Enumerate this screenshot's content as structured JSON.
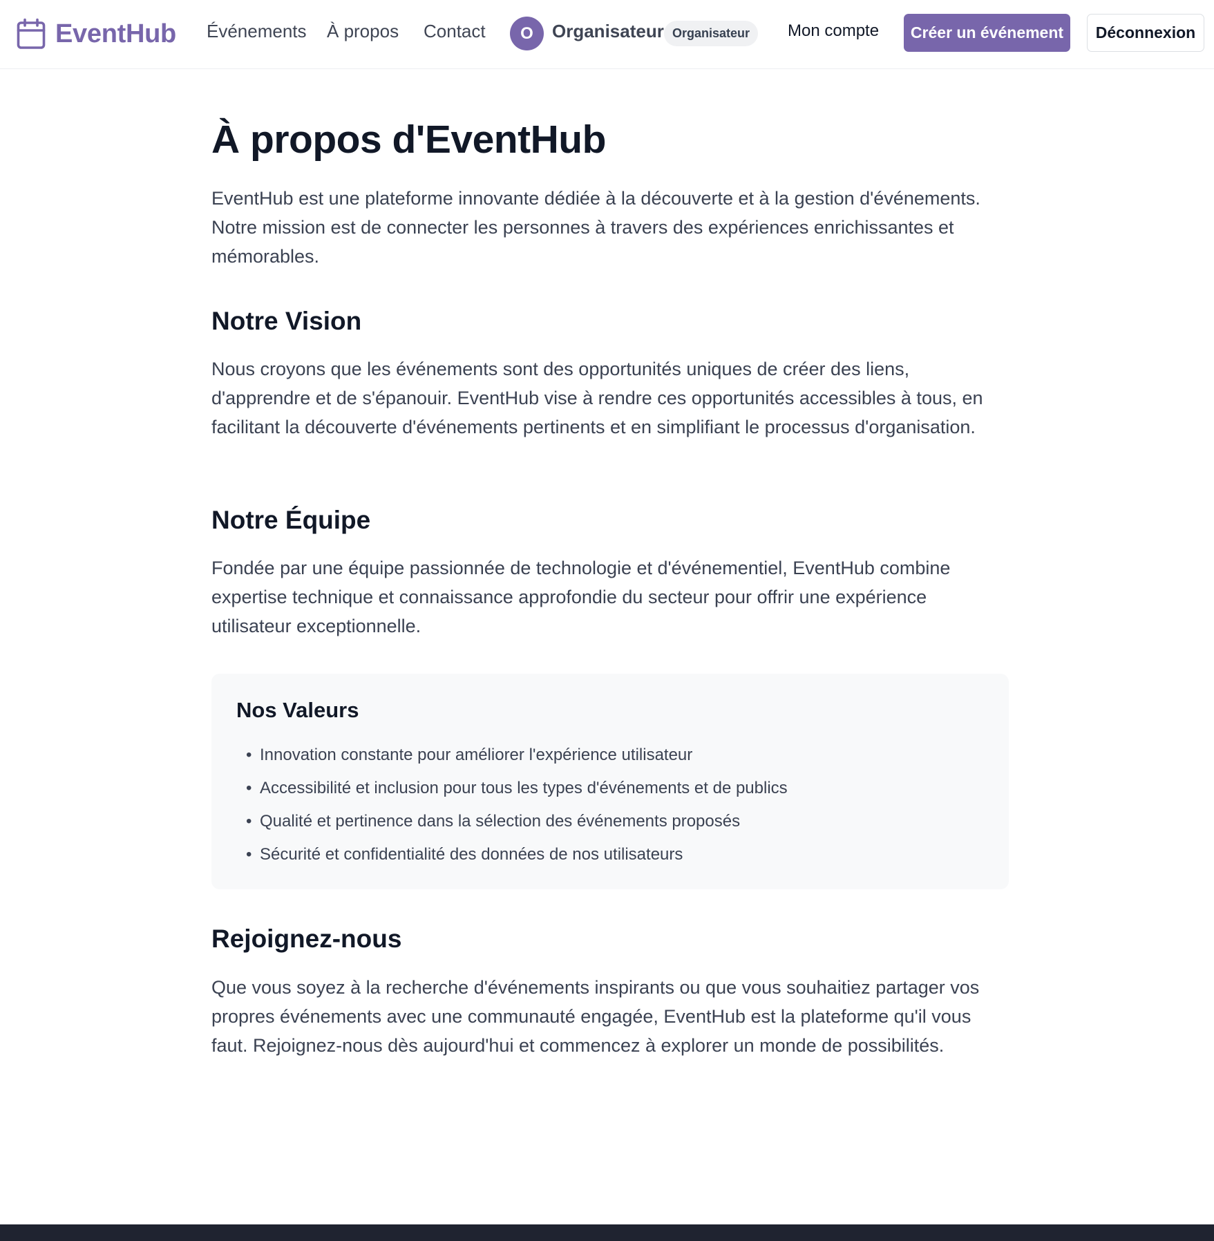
{
  "brand": {
    "name": "EventHub",
    "accent_color": "#7866ab",
    "logo_icon": "calendar-icon"
  },
  "nav": {
    "links": [
      "Événements",
      "À propos",
      "Contact"
    ]
  },
  "user": {
    "initial": "O",
    "name": "Organisateur",
    "role_badge": "Organisateur",
    "account_link": "Mon compte"
  },
  "actions": {
    "create_event": "Créer un événement",
    "logout": "Déconnexion"
  },
  "page": {
    "title": "À propos d'EventHub",
    "intro": "EventHub est une plateforme innovante dédiée à la découverte et à la gestion d'événements. Notre mission est de connecter les personnes à travers des expériences enrichissantes et mémorables.",
    "sections": [
      {
        "heading": "Notre Vision",
        "text": "Nous croyons que les événements sont des opportunités uniques de créer des liens, d'apprendre et de s'épanouir. EventHub vise à rendre ces opportunités accessibles à tous, en facilitant la découverte d'événements pertinents et en simplifiant le processus d'organisation."
      },
      {
        "heading": "Notre Équipe",
        "text": "Fondée par une équipe passionnée de technologie et d'événementiel, EventHub combine expertise technique et connaissance approfondie du secteur pour offrir une expérience utilisateur exceptionnelle."
      },
      {
        "heading": "Rejoignez-nous",
        "text": "Que vous soyez à la recherche d'événements inspirants ou que vous souhaitiez partager vos propres événements avec une communauté engagée, EventHub est la plateforme qu'il vous faut. Rejoignez-nous dès aujourd'hui et commencez à explorer un monde de possibilités."
      }
    ],
    "values": {
      "heading": "Nos Valeurs",
      "items": [
        "Innovation constante pour améliorer l'expérience utilisateur",
        "Accessibilité et inclusion pour tous les types d'événements et de publics",
        "Qualité et pertinence dans la sélection des événements proposés",
        "Sécurité et confidentialité des données de nos utilisateurs"
      ]
    }
  }
}
